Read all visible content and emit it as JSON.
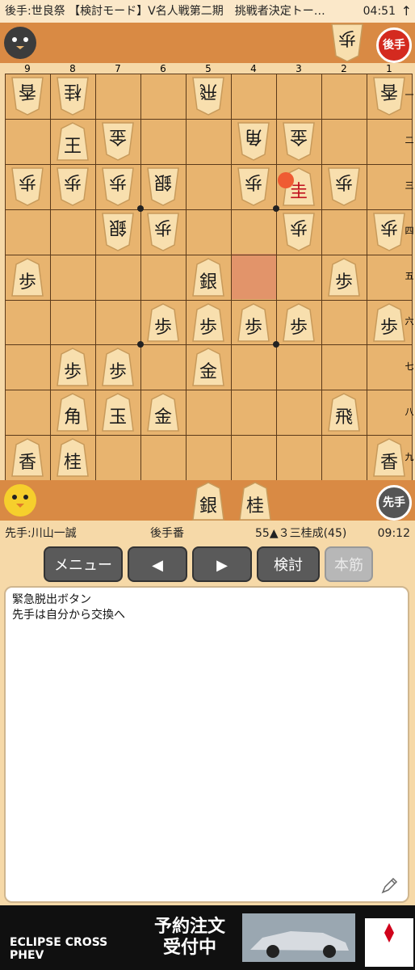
{
  "topbar": {
    "title": "後手:世良祭 【検討モード】V名人戦第二期　挑戦者決定トー…",
    "time": "04:51",
    "up": "↑"
  },
  "gote_hand": {
    "badge": "後手",
    "pieces": [
      "歩"
    ]
  },
  "sente_hand": {
    "badge": "先手",
    "pieces": [
      "銀",
      "桂"
    ]
  },
  "board": {
    "columns": [
      "9",
      "8",
      "7",
      "6",
      "5",
      "4",
      "3",
      "2",
      "1"
    ],
    "rows": [
      "一",
      "二",
      "三",
      "四",
      "五",
      "六",
      "七",
      "八",
      "九"
    ]
  },
  "status": {
    "sente_name": "先手:川山一誠",
    "turn": "後手番",
    "move": "55▲３三桂成(45)",
    "clock": "09:12"
  },
  "buttons": {
    "menu": "メニュー",
    "prev": "◀",
    "next": "▶",
    "review": "検討",
    "mainline": "本筋"
  },
  "comment": {
    "line1": "緊急脱出ボタン",
    "line2": "先手は自分から交換へ"
  },
  "ad": {
    "brand_line1": "ECLIPSE CROSS",
    "brand_line2": "PHEV",
    "cta_line1": "予約注文",
    "cta_line2": "受付中"
  }
}
